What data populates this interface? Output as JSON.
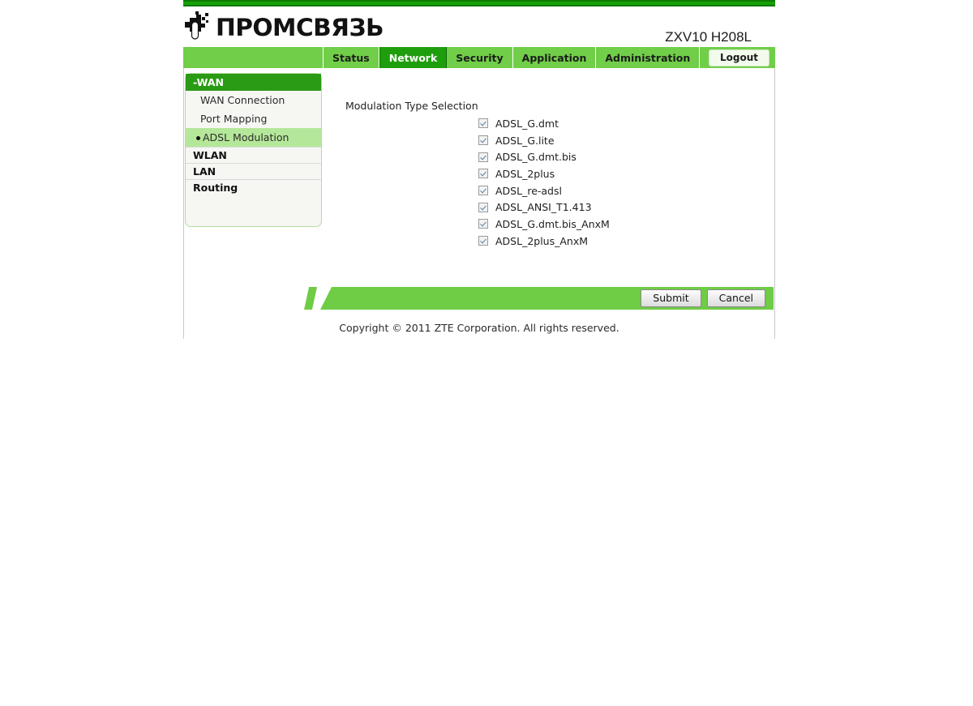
{
  "brand": {
    "logo_text": "ПРОМСВЯЗЬ",
    "logo_icon": "plug-connector-icon",
    "model_name": "ZXV10 H208L"
  },
  "nav": {
    "tabs": [
      {
        "label": "Status",
        "active": false
      },
      {
        "label": "Network",
        "active": true
      },
      {
        "label": "Security",
        "active": false
      },
      {
        "label": "Application",
        "active": false
      },
      {
        "label": "Administration",
        "active": false
      }
    ],
    "logout_label": "Logout"
  },
  "sidebar": {
    "group_label": "-WAN",
    "items": [
      {
        "label": "WAN Connection",
        "selected": false
      },
      {
        "label": "Port Mapping",
        "selected": false
      },
      {
        "label": "ADSL Modulation",
        "selected": true
      }
    ],
    "sections": [
      {
        "label": "WLAN"
      },
      {
        "label": "LAN"
      },
      {
        "label": "Routing"
      }
    ]
  },
  "main": {
    "section_title": "Modulation Type Selection",
    "modulation_types": [
      {
        "label": "ADSL_G.dmt",
        "checked": true
      },
      {
        "label": "ADSL_G.lite",
        "checked": true
      },
      {
        "label": "ADSL_G.dmt.bis",
        "checked": true
      },
      {
        "label": "ADSL_2plus",
        "checked": true
      },
      {
        "label": "ADSL_re-adsl",
        "checked": true
      },
      {
        "label": "ADSL_ANSI_T1.413",
        "checked": true
      },
      {
        "label": "ADSL_G.dmt.bis_AnxM",
        "checked": true
      },
      {
        "label": "ADSL_2plus_AnxM",
        "checked": true
      }
    ]
  },
  "actions": {
    "submit_label": "Submit",
    "cancel_label": "Cancel"
  },
  "footer": {
    "copyright": "Copyright © 2011 ZTE Corporation. All rights reserved."
  },
  "colors": {
    "top_rule": "#16a006",
    "nav_bar": "#71ce48",
    "nav_active": "#1f9e0d",
    "group_head": "#2a9b15",
    "selected_item": "#b5e79a",
    "action_bar": "#6fcc45"
  }
}
